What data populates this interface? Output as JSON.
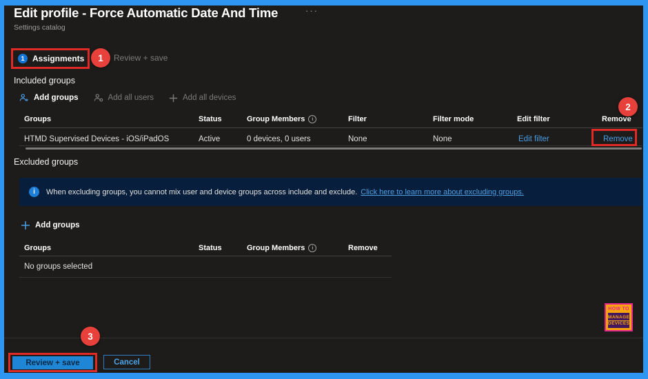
{
  "colors": {
    "frame_blue": "#2e96f0",
    "background": "#1d1c1b",
    "link_blue": "#4a9fe6",
    "annotation_red": "#df2a26",
    "primary_button_blue": "#1e86d4",
    "banner_navy": "#071f3c",
    "step_badge_blue": "#1374d8"
  },
  "header": {
    "title": "Edit profile - Force Automatic Date And Time",
    "subtitle": "Settings catalog",
    "more": "···"
  },
  "tabs": {
    "assignments": {
      "label": "Assignments",
      "step": "1"
    },
    "review": {
      "label": "Review + save"
    }
  },
  "annotations": {
    "step1": "1",
    "step2": "2",
    "step3": "3"
  },
  "included": {
    "heading": "Included groups",
    "toolbar": {
      "add_groups": "Add groups",
      "add_all_users": "Add all users",
      "add_all_devices": "Add all devices"
    },
    "headers": [
      "Groups",
      "Status",
      "Group Members",
      "Filter",
      "Filter mode",
      "Edit filter",
      "Remove"
    ],
    "row": {
      "group": "HTMD Supervised Devices - iOS/iPadOS",
      "status": "Active",
      "members": "0 devices, 0 users",
      "filter": "None",
      "filter_mode": "None",
      "edit_filter": "Edit filter",
      "remove": "Remove"
    }
  },
  "excluded": {
    "heading": "Excluded groups",
    "banner": {
      "text": "When excluding groups, you cannot mix user and device groups across include and exclude.",
      "link": "Click here to learn more about excluding groups."
    },
    "toolbar": {
      "add_groups": "Add groups"
    },
    "headers": [
      "Groups",
      "Status",
      "Group Members",
      "Remove"
    ],
    "empty": "No groups selected"
  },
  "footer": {
    "review_save": "Review + save",
    "cancel": "Cancel"
  },
  "logo": {
    "top": "HOW TO",
    "mid": "MANAGE",
    "bottom": "DEVICES"
  }
}
